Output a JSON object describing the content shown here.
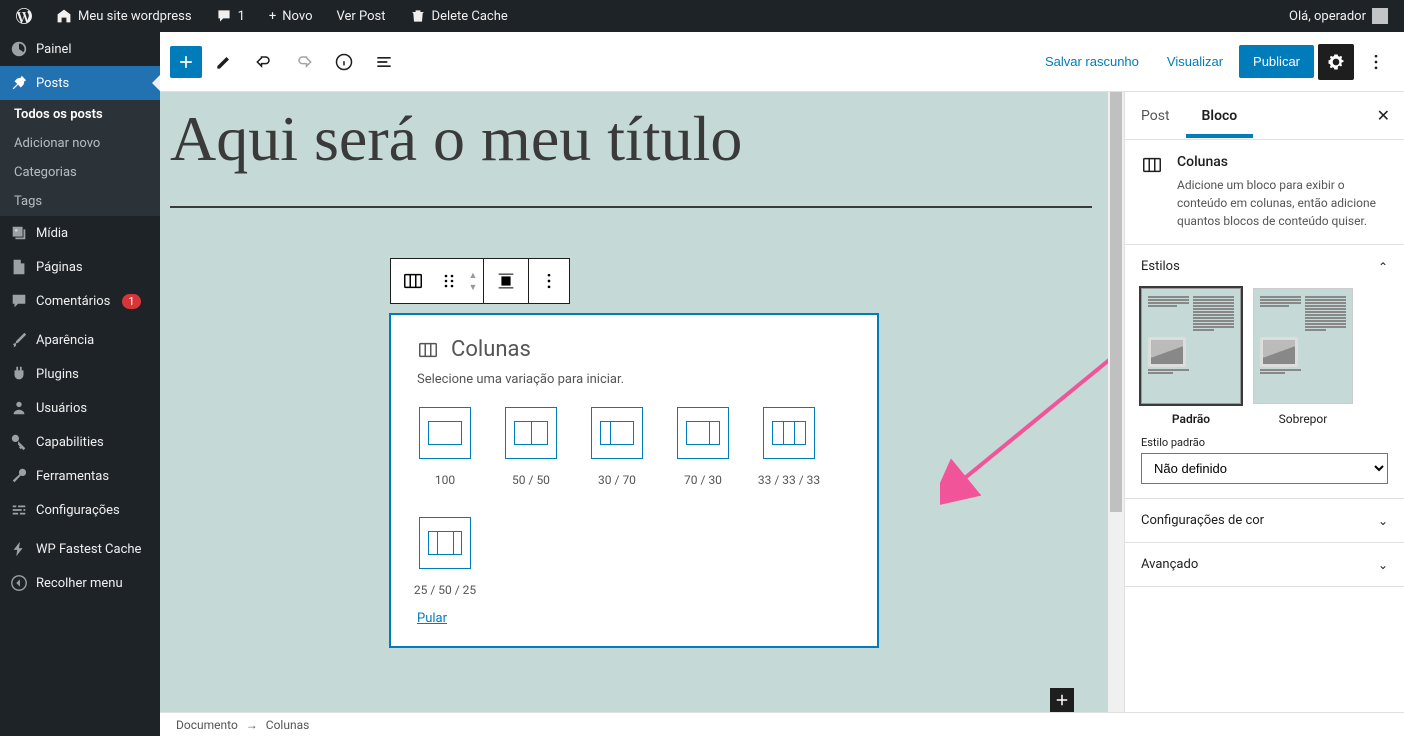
{
  "admin_bar": {
    "site_name": "Meu site wordpress",
    "comments_count": "1",
    "new_label": "Novo",
    "view_post": "Ver Post",
    "delete_cache": "Delete Cache",
    "greeting": "Olá, operador"
  },
  "sidebar": {
    "painel": "Painel",
    "posts": "Posts",
    "submenu": {
      "all": "Todos os posts",
      "add": "Adicionar novo",
      "cat": "Categorias",
      "tags": "Tags"
    },
    "midia": "Mídia",
    "paginas": "Páginas",
    "comentarios": "Comentários",
    "comentarios_count": "1",
    "aparencia": "Aparência",
    "plugins": "Plugins",
    "usuarios": "Usuários",
    "capabilities": "Capabilities",
    "ferramentas": "Ferramentas",
    "config": "Configurações",
    "fastest": "WP Fastest Cache",
    "collapse": "Recolher menu"
  },
  "editor": {
    "save_draft": "Salvar rascunho",
    "preview": "Visualizar",
    "publish": "Publicar",
    "title": "Aqui será o meu título"
  },
  "columns_block": {
    "name": "Colunas",
    "instruction": "Selecione uma variação para iniciar.",
    "variations": [
      {
        "label": "100",
        "cols": [
          1
        ]
      },
      {
        "label": "50 / 50",
        "cols": [
          1,
          1
        ]
      },
      {
        "label": "30 / 70",
        "cols": [
          3,
          7
        ]
      },
      {
        "label": "70 / 30",
        "cols": [
          7,
          3
        ]
      },
      {
        "label": "33 / 33 / 33",
        "cols": [
          1,
          1,
          1
        ]
      },
      {
        "label": "25 / 50 / 25",
        "cols": [
          1,
          2,
          1
        ]
      }
    ],
    "skip": "Pular"
  },
  "inspector": {
    "tab_post": "Post",
    "tab_block": "Bloco",
    "block_title": "Colunas",
    "block_desc": "Adicione um bloco para exibir o conteúdo em colunas, então adicione quantos blocos de conteúdo quiser.",
    "styles_title": "Estilos",
    "style_default": "Padrão",
    "style_overlay": "Sobrepor",
    "default_style_label": "Estilo padrão",
    "default_style_value": "Não definido",
    "color_panel": "Configurações de cor",
    "advanced_panel": "Avançado"
  },
  "breadcrumb": {
    "doc": "Documento",
    "block": "Colunas"
  }
}
